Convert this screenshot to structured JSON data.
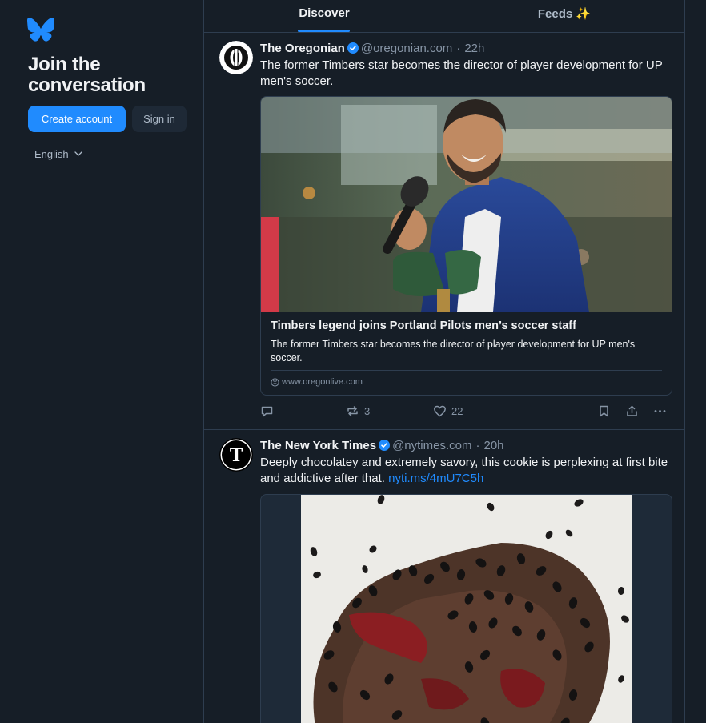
{
  "sidebar": {
    "logo_icon": "butterfly-logo-icon",
    "heading": "Join the conversation",
    "create_account_label": "Create account",
    "sign_in_label": "Sign in",
    "language_label": "English"
  },
  "tabs": [
    {
      "label": "Discover",
      "active": true
    },
    {
      "label": "Feeds ✨",
      "active": false
    }
  ],
  "posts": [
    {
      "author": "The Oregonian",
      "handle": "@oregonian.com",
      "time": "22h",
      "text": "The former Timbers star becomes the director of player development for UP men's soccer.",
      "embed": {
        "title": "Timbers legend joins Portland Pilots men’s soccer staff",
        "description": "The former Timbers star becomes the director of player development for UP men's soccer.",
        "domain": "www.oregonlive.com"
      },
      "reply_count": "",
      "repost_count": "3",
      "like_count": "22"
    },
    {
      "author": "The New York Times",
      "handle": "@nytimes.com",
      "time": "20h",
      "text": "Deeply chocolatey and extremely savory, this cookie is perplexing at first bite and addictive after that.",
      "link": "nyti.ms/4mU7C5h"
    }
  ],
  "colors": {
    "background": "#161e27",
    "accent": "#208bfe",
    "border": "#2e3d4f",
    "muted_text": "#8795a6"
  }
}
